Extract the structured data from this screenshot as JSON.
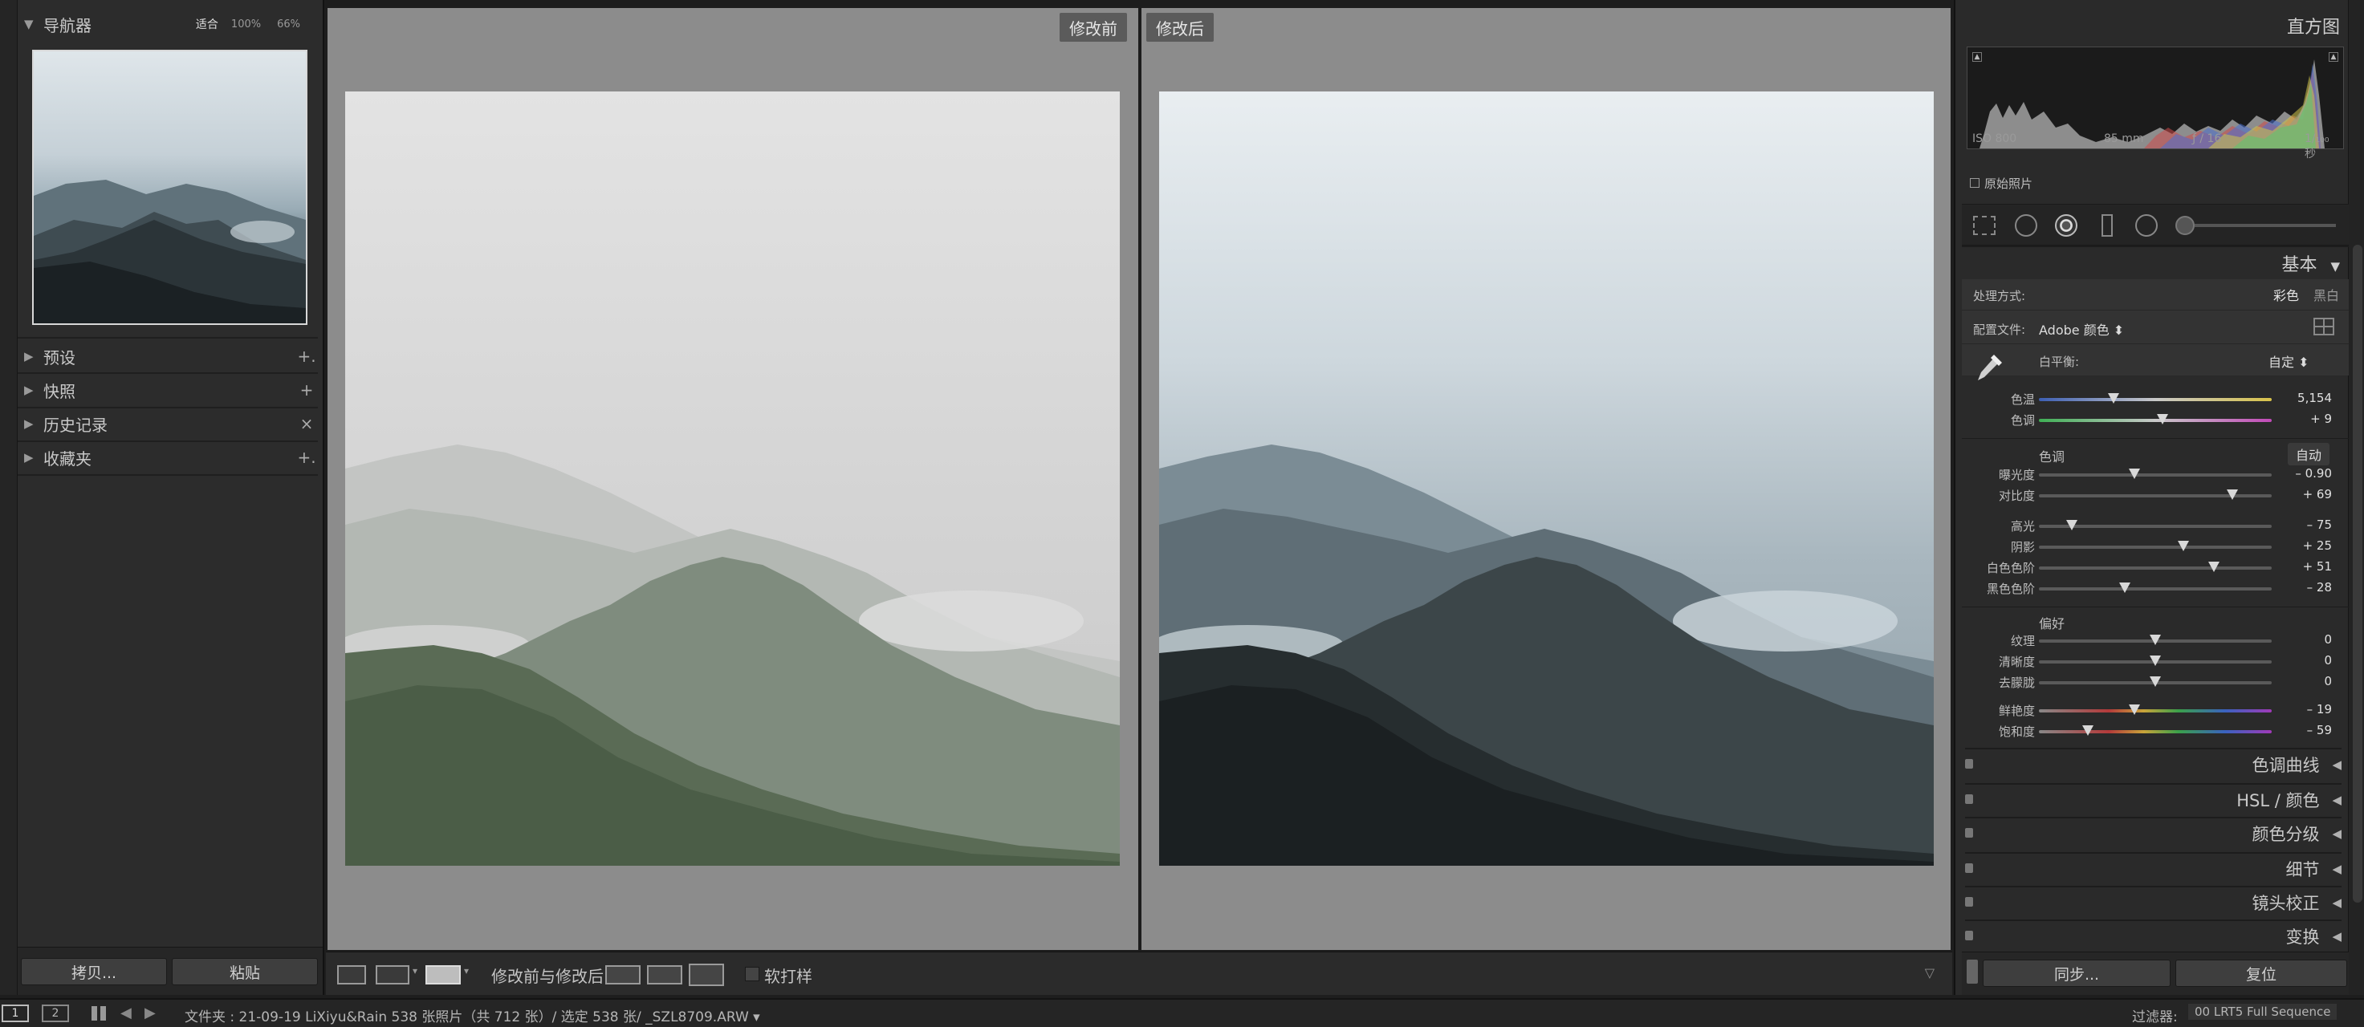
{
  "navigator": {
    "title": "导航器",
    "zoom_options": [
      "适合",
      "100%",
      "66%"
    ]
  },
  "left_sections": [
    {
      "label": "预设",
      "action": "+."
    },
    {
      "label": "快照",
      "action": "+"
    },
    {
      "label": "历史记录",
      "action": "×"
    },
    {
      "label": "收藏夹",
      "action": "+."
    }
  ],
  "left_buttons": {
    "copy": "拷贝...",
    "paste": "粘贴"
  },
  "views": {
    "before_label": "修改前",
    "after_label": "修改后"
  },
  "toolbar": {
    "mode_label": "修改前与修改后:",
    "softproof_label": "软打样"
  },
  "histogram": {
    "title": "直方图",
    "iso": "ISO 800",
    "focal": "85 mm",
    "aperture": "ƒ / 16",
    "shutter": "1/₁₀₀ 秒",
    "original_label": "原始照片"
  },
  "basic": {
    "title": "基本",
    "treatment_label": "处理方式:",
    "color_label": "彩色",
    "bw_label": "黑白",
    "profile_label": "配置文件:",
    "profile_value": "Adobe 颜色 ⬍",
    "wb_label": "白平衡:",
    "wb_value": "自定 ⬍",
    "tone_label": "色调",
    "auto_label": "自动",
    "presence_label": "偏好",
    "sliders": [
      {
        "label": "色温",
        "value": "5,154",
        "pos": 0.32,
        "track": "temp"
      },
      {
        "label": "色调",
        "value": "+ 9",
        "pos": 0.53,
        "track": "tint"
      },
      {
        "label": "曝光度",
        "value": "– 0.90",
        "pos": 0.41,
        "track": "gray"
      },
      {
        "label": "对比度",
        "value": "+ 69",
        "pos": 0.83,
        "track": "gray"
      },
      {
        "label": "高光",
        "value": "– 75",
        "pos": 0.14,
        "track": "gray"
      },
      {
        "label": "阴影",
        "value": "+ 25",
        "pos": 0.62,
        "track": "gray"
      },
      {
        "label": "白色色阶",
        "value": "+ 51",
        "pos": 0.75,
        "track": "gray"
      },
      {
        "label": "黑色色阶",
        "value": "– 28",
        "pos": 0.37,
        "track": "gray"
      },
      {
        "label": "纹理",
        "value": "0",
        "pos": 0.5,
        "track": "gray"
      },
      {
        "label": "清晰度",
        "value": "0",
        "pos": 0.5,
        "track": "gray"
      },
      {
        "label": "去朦胧",
        "value": "0",
        "pos": 0.5,
        "track": "gray"
      },
      {
        "label": "鲜艳度",
        "value": "– 19",
        "pos": 0.41,
        "track": "vib"
      },
      {
        "label": "饱和度",
        "value": "– 59",
        "pos": 0.21,
        "track": "vib"
      }
    ]
  },
  "right_sections": [
    "色调曲线",
    "HSL / 颜色",
    "颜色分级",
    "细节",
    "镜头校正",
    "变换"
  ],
  "right_buttons": {
    "sync": "同步...",
    "reset": "复位"
  },
  "statusbar": {
    "page1": "1",
    "page2": "2",
    "info": "文件夹 : 21-09-19 LiXiyu&Rain    538 张照片（共 712 张）/ 选定 538 张/ _SZL8709.ARW ▾",
    "filter_label": "过滤器:",
    "filter_value": "00 LRT5 Full Sequence"
  }
}
